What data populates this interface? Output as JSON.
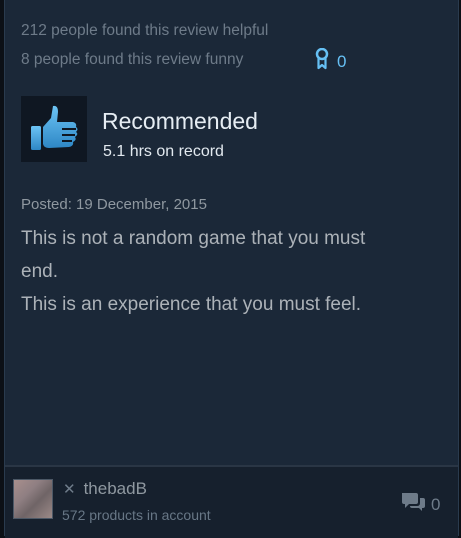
{
  "review": {
    "helpful_text": "212 people found this review helpful",
    "funny_text": "8 people found this review funny",
    "award_count": "0",
    "recommendation": "Recommended",
    "hours": "5.1 hrs on record",
    "posted": "Posted: 19 December, 2015",
    "body_lines": [
      "This is not a random game that you must",
      "end.",
      "This is an experience that you must feel."
    ]
  },
  "author": {
    "name": "thebadB",
    "products": "572 products in account",
    "comment_count": "0"
  },
  "icons": {
    "award": "award-ribbon-icon",
    "thumb": "thumbs-up-icon",
    "comment": "comment-bubble-icon",
    "x_mark": "x-mark-icon"
  },
  "colors": {
    "background": "#1b2838",
    "accent": "#66c0f4",
    "thumb_blue": "#4fa8e0"
  }
}
